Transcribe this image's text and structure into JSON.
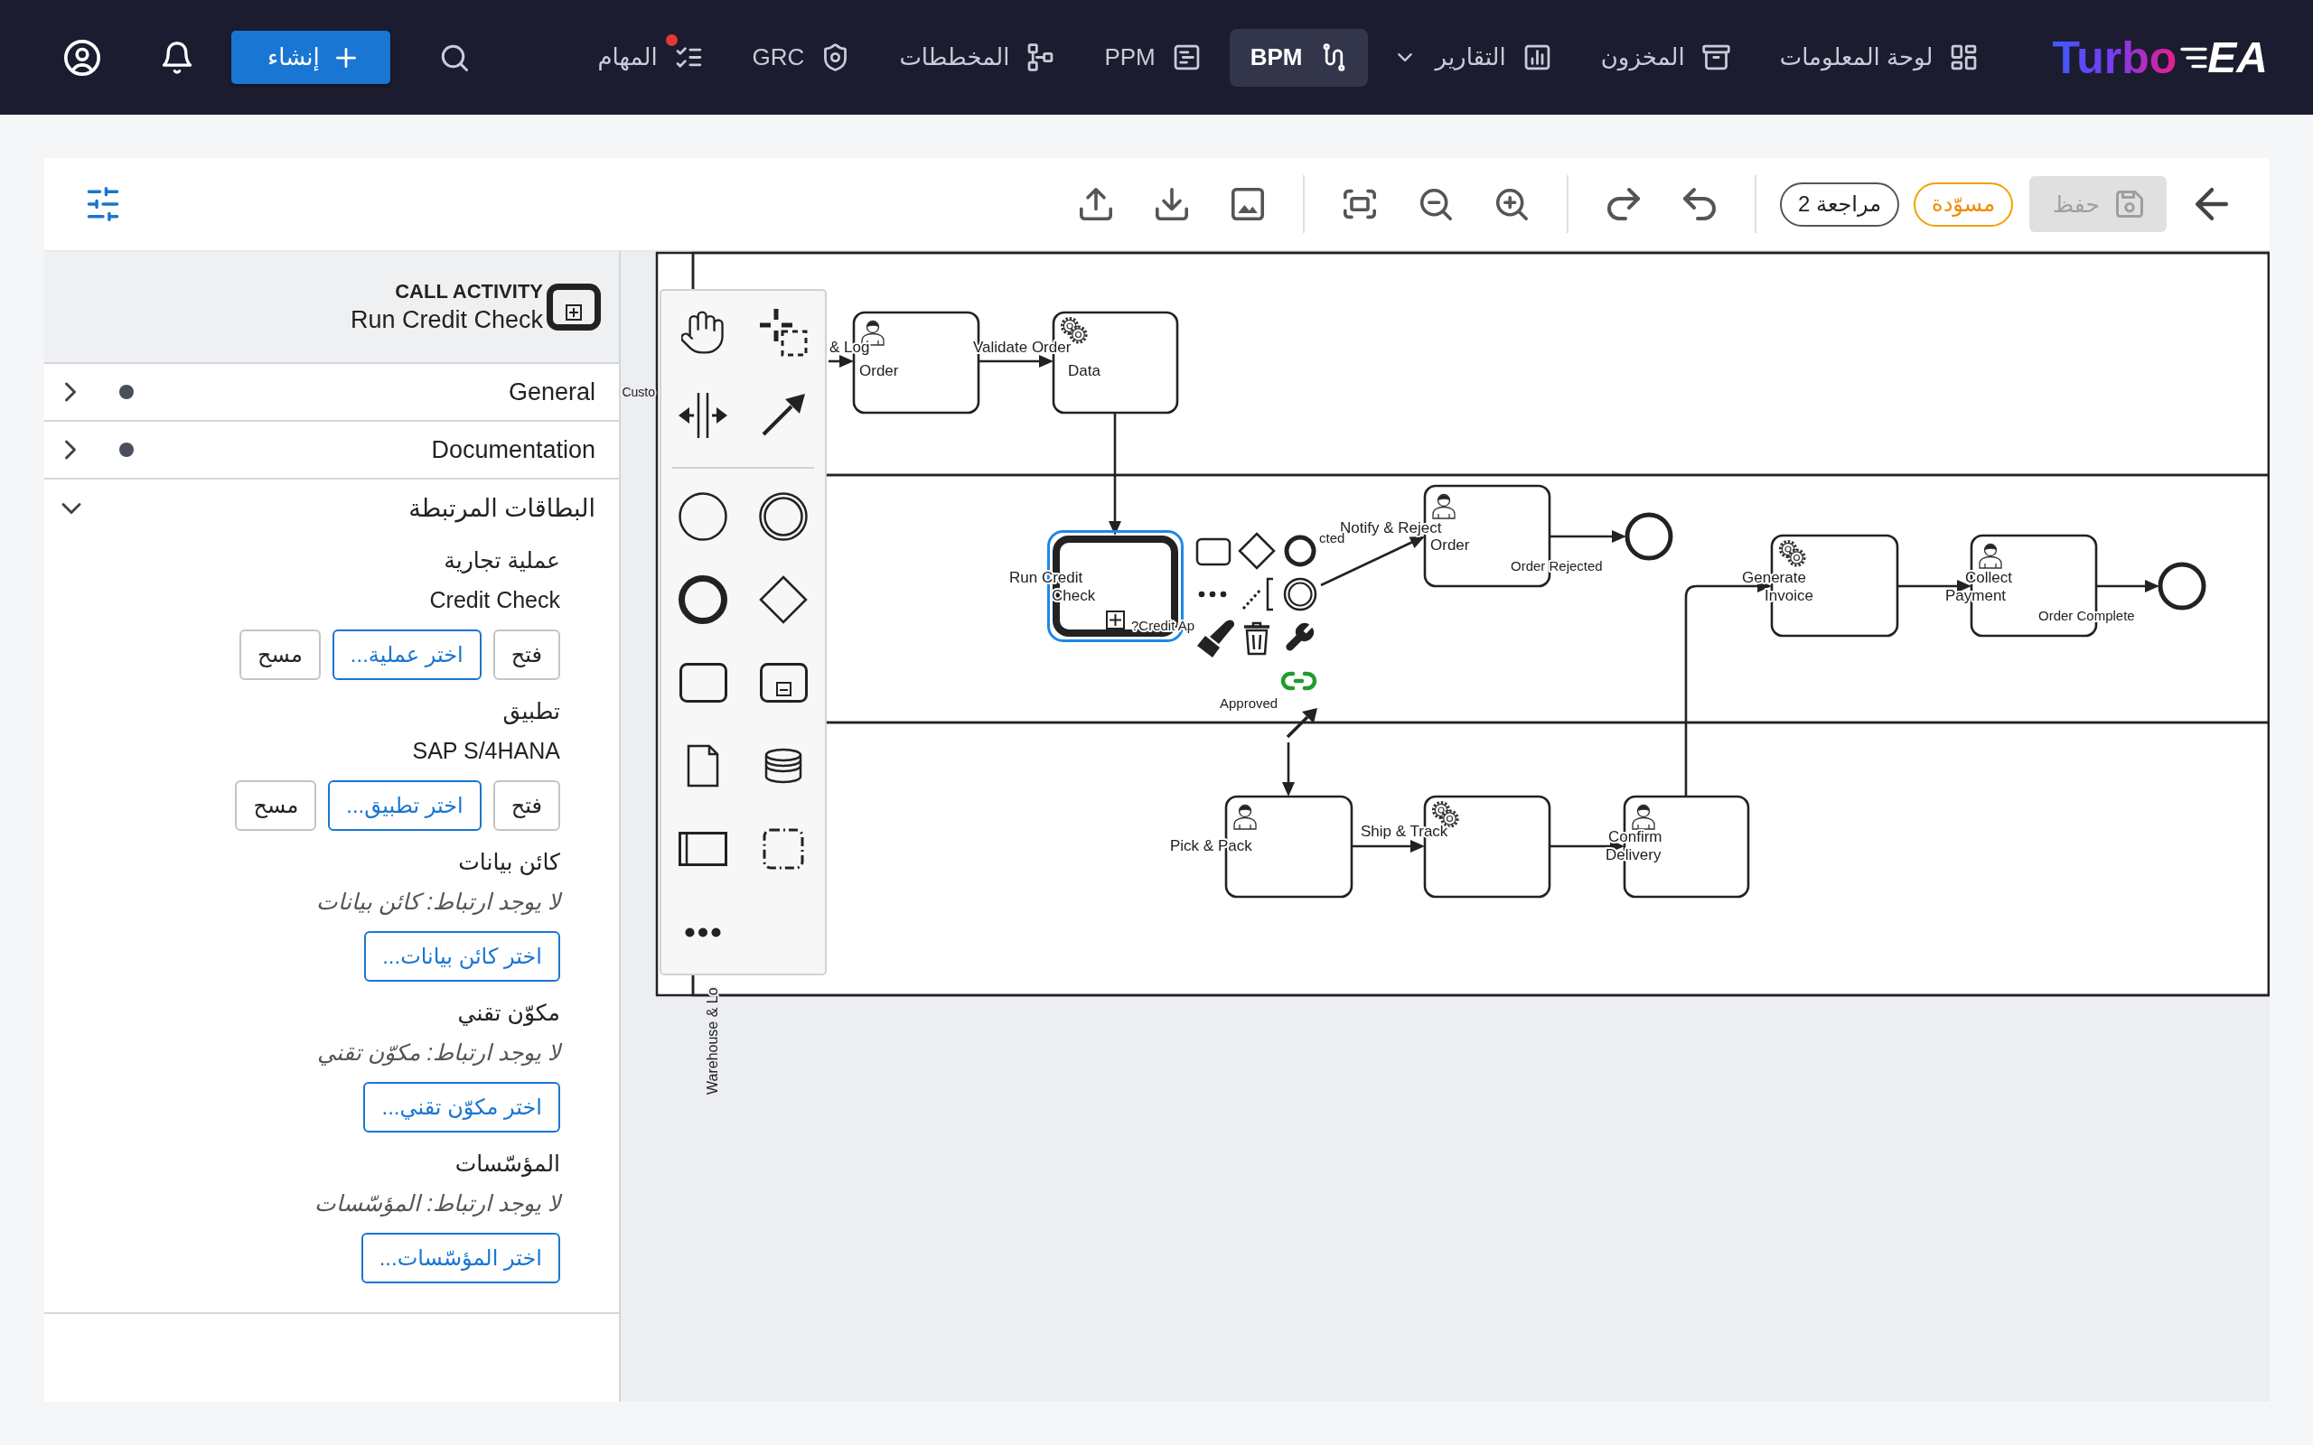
{
  "nav": {
    "logo": {
      "word": "Turbo",
      "mark": "EA"
    },
    "items": [
      {
        "label": "لوحة المعلومات",
        "selected": false,
        "dropdown": false,
        "alert": false
      },
      {
        "label": "المخزون",
        "selected": false,
        "dropdown": false,
        "alert": false
      },
      {
        "label": "التقارير",
        "selected": false,
        "dropdown": true,
        "alert": false
      },
      {
        "label": "BPM",
        "selected": true,
        "dropdown": false,
        "alert": false
      },
      {
        "label": "PPM",
        "selected": false,
        "dropdown": false,
        "alert": false
      },
      {
        "label": "المخططات",
        "selected": false,
        "dropdown": false,
        "alert": false
      },
      {
        "label": "GRC",
        "selected": false,
        "dropdown": false,
        "alert": false
      },
      {
        "label": "المهام",
        "selected": false,
        "dropdown": false,
        "alert": true
      }
    ],
    "create_button": "إنشاء"
  },
  "toolbar": {
    "save": {
      "label": "حفظ",
      "disabled": true
    },
    "status": "مسوّدة",
    "revision": "مراجعة 2"
  },
  "diagram": {
    "lane_labels": [
      "Custo",
      "Warehouse & Lo"
    ],
    "tasks": [
      {
        "kind": "service",
        "label": [
          "Validate Order",
          "Data"
        ],
        "selected": false
      },
      {
        "kind": "user",
        "label": [
          "& Log",
          "Order"
        ],
        "selected": false
      },
      {
        "kind": "user",
        "label": [
          "Collect",
          "Payment"
        ],
        "selected": false
      },
      {
        "kind": "service",
        "label": [
          "Generate",
          "Invoice"
        ],
        "selected": false
      },
      {
        "kind": "user",
        "label": [
          "Notify & Reject",
          "Order"
        ],
        "selected": false
      },
      {
        "kind": "call",
        "label": [
          "Run Credit",
          "Check"
        ],
        "selected": true
      },
      {
        "kind": "user",
        "label": [
          "Confirm",
          "Delivery"
        ],
        "selected": false
      },
      {
        "kind": "service",
        "label": [
          "Ship & Track"
        ],
        "selected": false
      },
      {
        "kind": "user",
        "label": [
          "Pick & Pack"
        ],
        "selected": false
      }
    ],
    "labels": [
      "?Credit Ap",
      "cted",
      "Approved",
      "Order Rejected",
      "Order Complete"
    ]
  },
  "panel": {
    "type": "CALL ACTIVITY",
    "name": "Run Credit Check",
    "sections": [
      {
        "title": "General",
        "expanded": false,
        "filled": true
      },
      {
        "title": "Documentation",
        "expanded": false,
        "filled": true
      },
      {
        "title": "البطاقات المرتبطة",
        "expanded": true,
        "filled": false,
        "groups": [
          {
            "label": "عملية تجارية",
            "value": "Credit Check",
            "buttons": [
              {
                "label": "فتح",
                "kind": "open"
              },
              {
                "label": "اختر عملية...",
                "kind": "pick"
              },
              {
                "label": "مسح",
                "kind": "clear"
              }
            ]
          },
          {
            "label": "تطبيق",
            "value": "SAP S/4HANA",
            "buttons": [
              {
                "label": "فتح",
                "kind": "open"
              },
              {
                "label": "اختر تطبيق...",
                "kind": "pick"
              },
              {
                "label": "مسح",
                "kind": "clear"
              }
            ]
          },
          {
            "label": "كائن بيانات",
            "empty": "لا يوجد ارتباط: كائن بيانات",
            "buttons": [
              {
                "label": "اختر كائن بيانات...",
                "kind": "pick"
              }
            ]
          },
          {
            "label": "مكوّن تقني",
            "empty": "لا يوجد ارتباط: مكوّن تقني",
            "buttons": [
              {
                "label": "اختر مكوّن تقني...",
                "kind": "pick"
              }
            ]
          },
          {
            "label": "المؤسّسات",
            "empty": "لا يوجد ارتباط: المؤسّسات",
            "buttons": [
              {
                "label": "اختر المؤسّسات...",
                "kind": "pick"
              }
            ]
          }
        ]
      }
    ]
  }
}
